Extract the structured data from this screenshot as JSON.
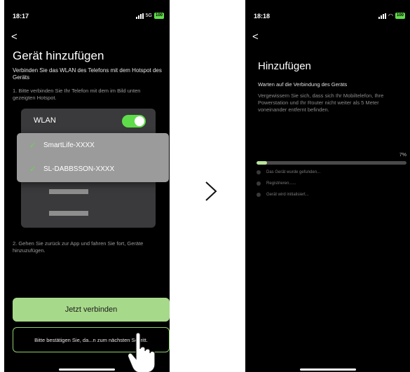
{
  "left_screen": {
    "status": {
      "time": "18:17",
      "network": "5G",
      "battery": "100"
    },
    "back": "<",
    "title": "Gerät hinzufügen",
    "subtitle": "Verbinden Sie das WLAN des Telefons mit dem Hotspot des Geräts",
    "step1": "1. Bitte verbinden Sie Ihr Telefon mit dem im Bild unten gezeigten Hotspot.",
    "wlan_label": "WLAN",
    "networks": [
      "SmartLife-XXXX",
      "SL-DABBSSON-XXXX"
    ],
    "step2": "2. Gehen Sie zurück zur App und fahren Sie fort, Geräte hinzuzufügen.",
    "connect_button": "Jetzt verbinden",
    "confirm_button": "Bitte bestätigen Sie, da...n zum nächsten Schritt."
  },
  "separator": ">",
  "right_screen": {
    "status": {
      "time": "18:18",
      "battery": "100"
    },
    "back": "<",
    "title": "Hinzufügen",
    "subtitle": "Warten auf die Verbindung des Geräts",
    "description": "Vergewissern Sie sich, dass sich Ihr Mobiltelefon, Ihre Powerstation und Ihr Router nicht weiter als 5 Meter voneinander entfernt befinden.",
    "progress_label": "7%",
    "progress_value": 0.07,
    "stages": [
      "Das Gerät wurde gefunden...",
      "Registrieren......",
      "Gerät wird initialisiert..."
    ]
  },
  "colors": {
    "accent": "#5fdc4a",
    "button": "#a7d98a",
    "background": "#000000"
  }
}
